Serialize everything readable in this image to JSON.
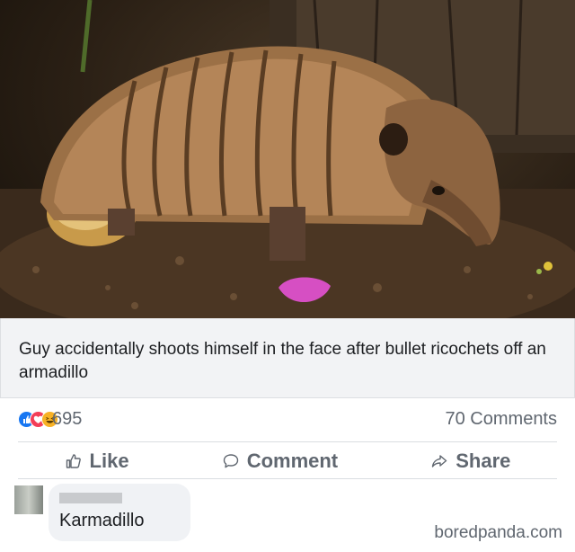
{
  "post": {
    "image": {
      "subject": "armadillo",
      "alt": "Armadillo sniffing the ground near a tree trunk"
    },
    "headline": "Guy accidentally shoots himself in the face after bullet ricochets off an armadillo",
    "reactions": {
      "icons": [
        "like-reaction-icon",
        "love-reaction-icon",
        "haha-reaction-icon"
      ],
      "count": "695"
    },
    "comments_count": "70 Comments",
    "actions": {
      "like": "Like",
      "comment": "Comment",
      "share": "Share"
    }
  },
  "comment": {
    "text": "Karmadillo"
  },
  "watermark": "boredpanda.com",
  "colors": {
    "like_blue": "#1877f2",
    "love_red": "#f33e58",
    "haha_yellow": "#f7b125",
    "muted_text": "#606770",
    "bubble_bg": "#f0f2f5"
  }
}
